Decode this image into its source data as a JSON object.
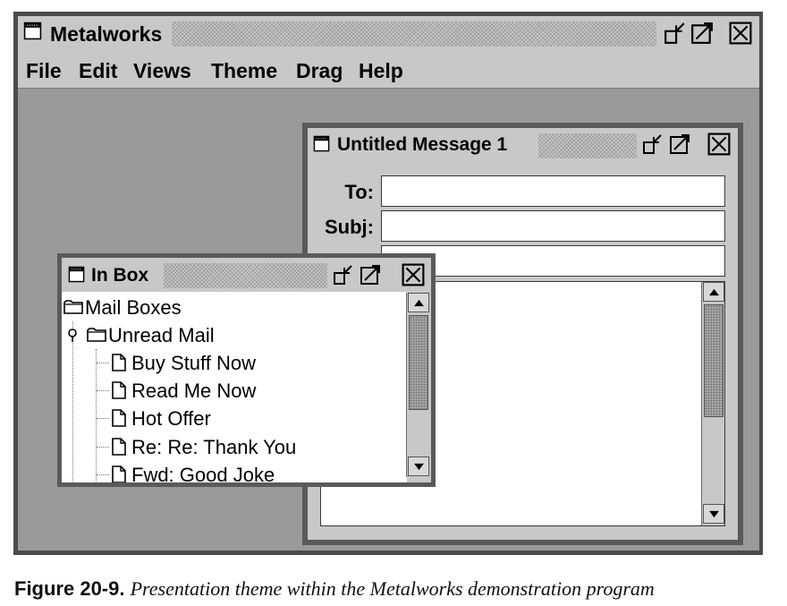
{
  "main_window": {
    "title": "Metalworks",
    "menu": [
      "File",
      "Edit",
      "Views",
      "Theme",
      "Drag",
      "Help"
    ]
  },
  "message_window": {
    "title": "Untitled Message 1",
    "to_label": "To:",
    "subj_label": "Subj:",
    "to_value": "",
    "subj_value": "",
    "third_value": ""
  },
  "inbox_window": {
    "title": "In Box",
    "tree": {
      "root": "Mail Boxes",
      "folder": "Unread Mail",
      "items": [
        "Buy Stuff Now",
        "Read Me Now",
        "Hot Offer",
        "Re: Re: Thank You",
        "Fwd: Good Joke"
      ]
    }
  },
  "caption": {
    "figure": "Figure 20-9.",
    "text": "Presentation theme within the Metalworks demonstration program"
  }
}
